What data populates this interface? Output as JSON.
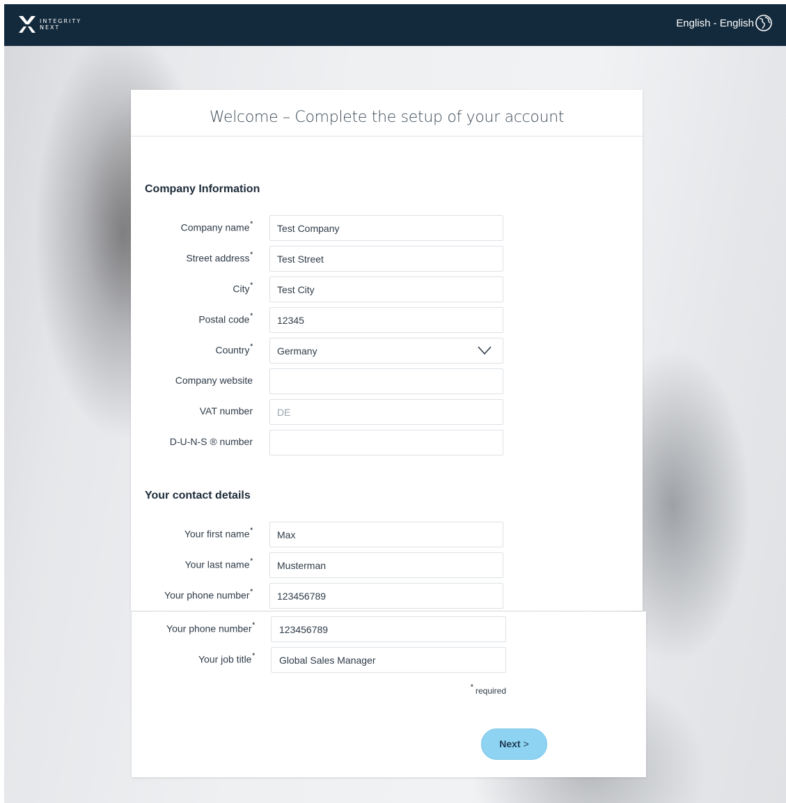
{
  "brand": {
    "line1": "INTEGRITY",
    "line2": "NEXT"
  },
  "header": {
    "language": "English - English"
  },
  "page_title": "Welcome – Complete the setup of your account",
  "company_section": {
    "title": "Company Information",
    "fields": [
      {
        "label": "Company name",
        "required": "*",
        "value": "Test Company",
        "placeholder": ""
      },
      {
        "label": "Street address",
        "required": "*",
        "value": "Test Street",
        "placeholder": ""
      },
      {
        "label": "City",
        "required": "*",
        "value": "Test City",
        "placeholder": ""
      },
      {
        "label": "Postal code",
        "required": "*",
        "value": "12345",
        "placeholder": ""
      },
      {
        "label": "Country",
        "required": "*",
        "value": "Germany",
        "placeholder": ""
      },
      {
        "label": "Company website",
        "required": "",
        "value": "",
        "placeholder": ""
      },
      {
        "label": "VAT number",
        "required": "",
        "value": "",
        "placeholder": "DE"
      },
      {
        "label": "D-U-N-S ® number",
        "required": "",
        "value": "",
        "placeholder": ""
      }
    ]
  },
  "contact_section": {
    "title": "Your contact details",
    "fields": [
      {
        "label": "Your first name",
        "required": "*",
        "value": "Max"
      },
      {
        "label": "Your last name",
        "required": "*",
        "value": "Musterman"
      },
      {
        "label": "Your phone number",
        "required": "*",
        "value": "123456789"
      }
    ]
  },
  "contact_continued": {
    "fields": [
      {
        "label": "Your phone number",
        "required": "*",
        "value": "123456789"
      },
      {
        "label": "Your job title",
        "required": "*",
        "value": "Global Sales Manager"
      }
    ]
  },
  "required_note": {
    "mark": "*",
    "text": "required"
  },
  "next_button": {
    "label": "Next",
    "arrow": ">"
  },
  "colors": {
    "topbar": "#132a3c",
    "button": "#8fd3f2",
    "text": "#2e3b48"
  }
}
